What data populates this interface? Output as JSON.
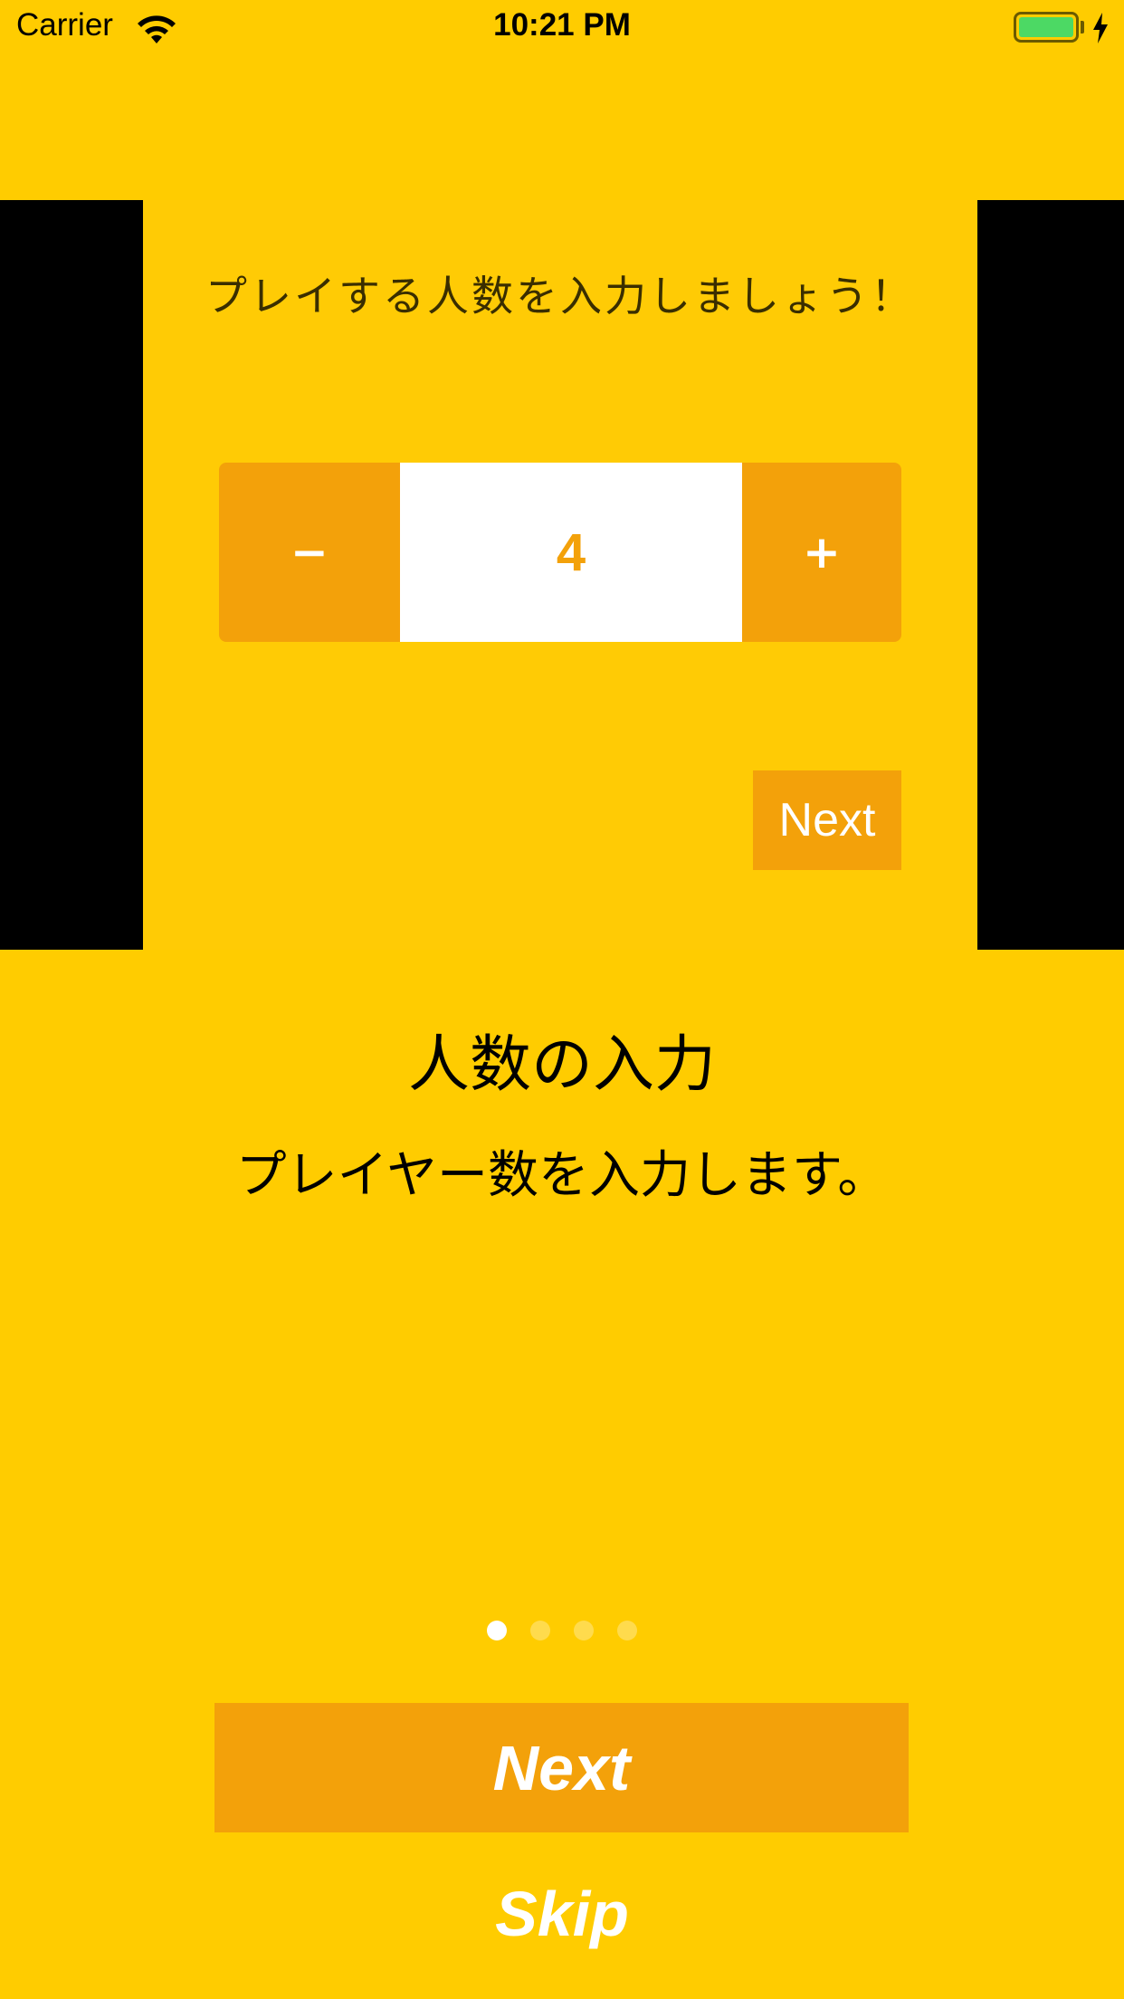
{
  "status_bar": {
    "carrier": "Carrier",
    "time": "10:21 PM",
    "icons": [
      "wifi-icon",
      "battery-icon",
      "charging-bolt-icon"
    ],
    "battery_color": "#4cd964"
  },
  "preview": {
    "prompt": "プレイする人数を入力しましょう！",
    "stepper": {
      "minus_label": "−",
      "value": "4",
      "plus_label": "+"
    },
    "next_label": "Next"
  },
  "page": {
    "title": "人数の入力",
    "description": "プレイヤー数を入力します。"
  },
  "pager": {
    "count": 4,
    "active_index": 0
  },
  "actions": {
    "next_label": "Next",
    "skip_label": "Skip"
  },
  "colors": {
    "background": "#FFCC00",
    "accent": "#F3A10A",
    "text": "#000000"
  }
}
